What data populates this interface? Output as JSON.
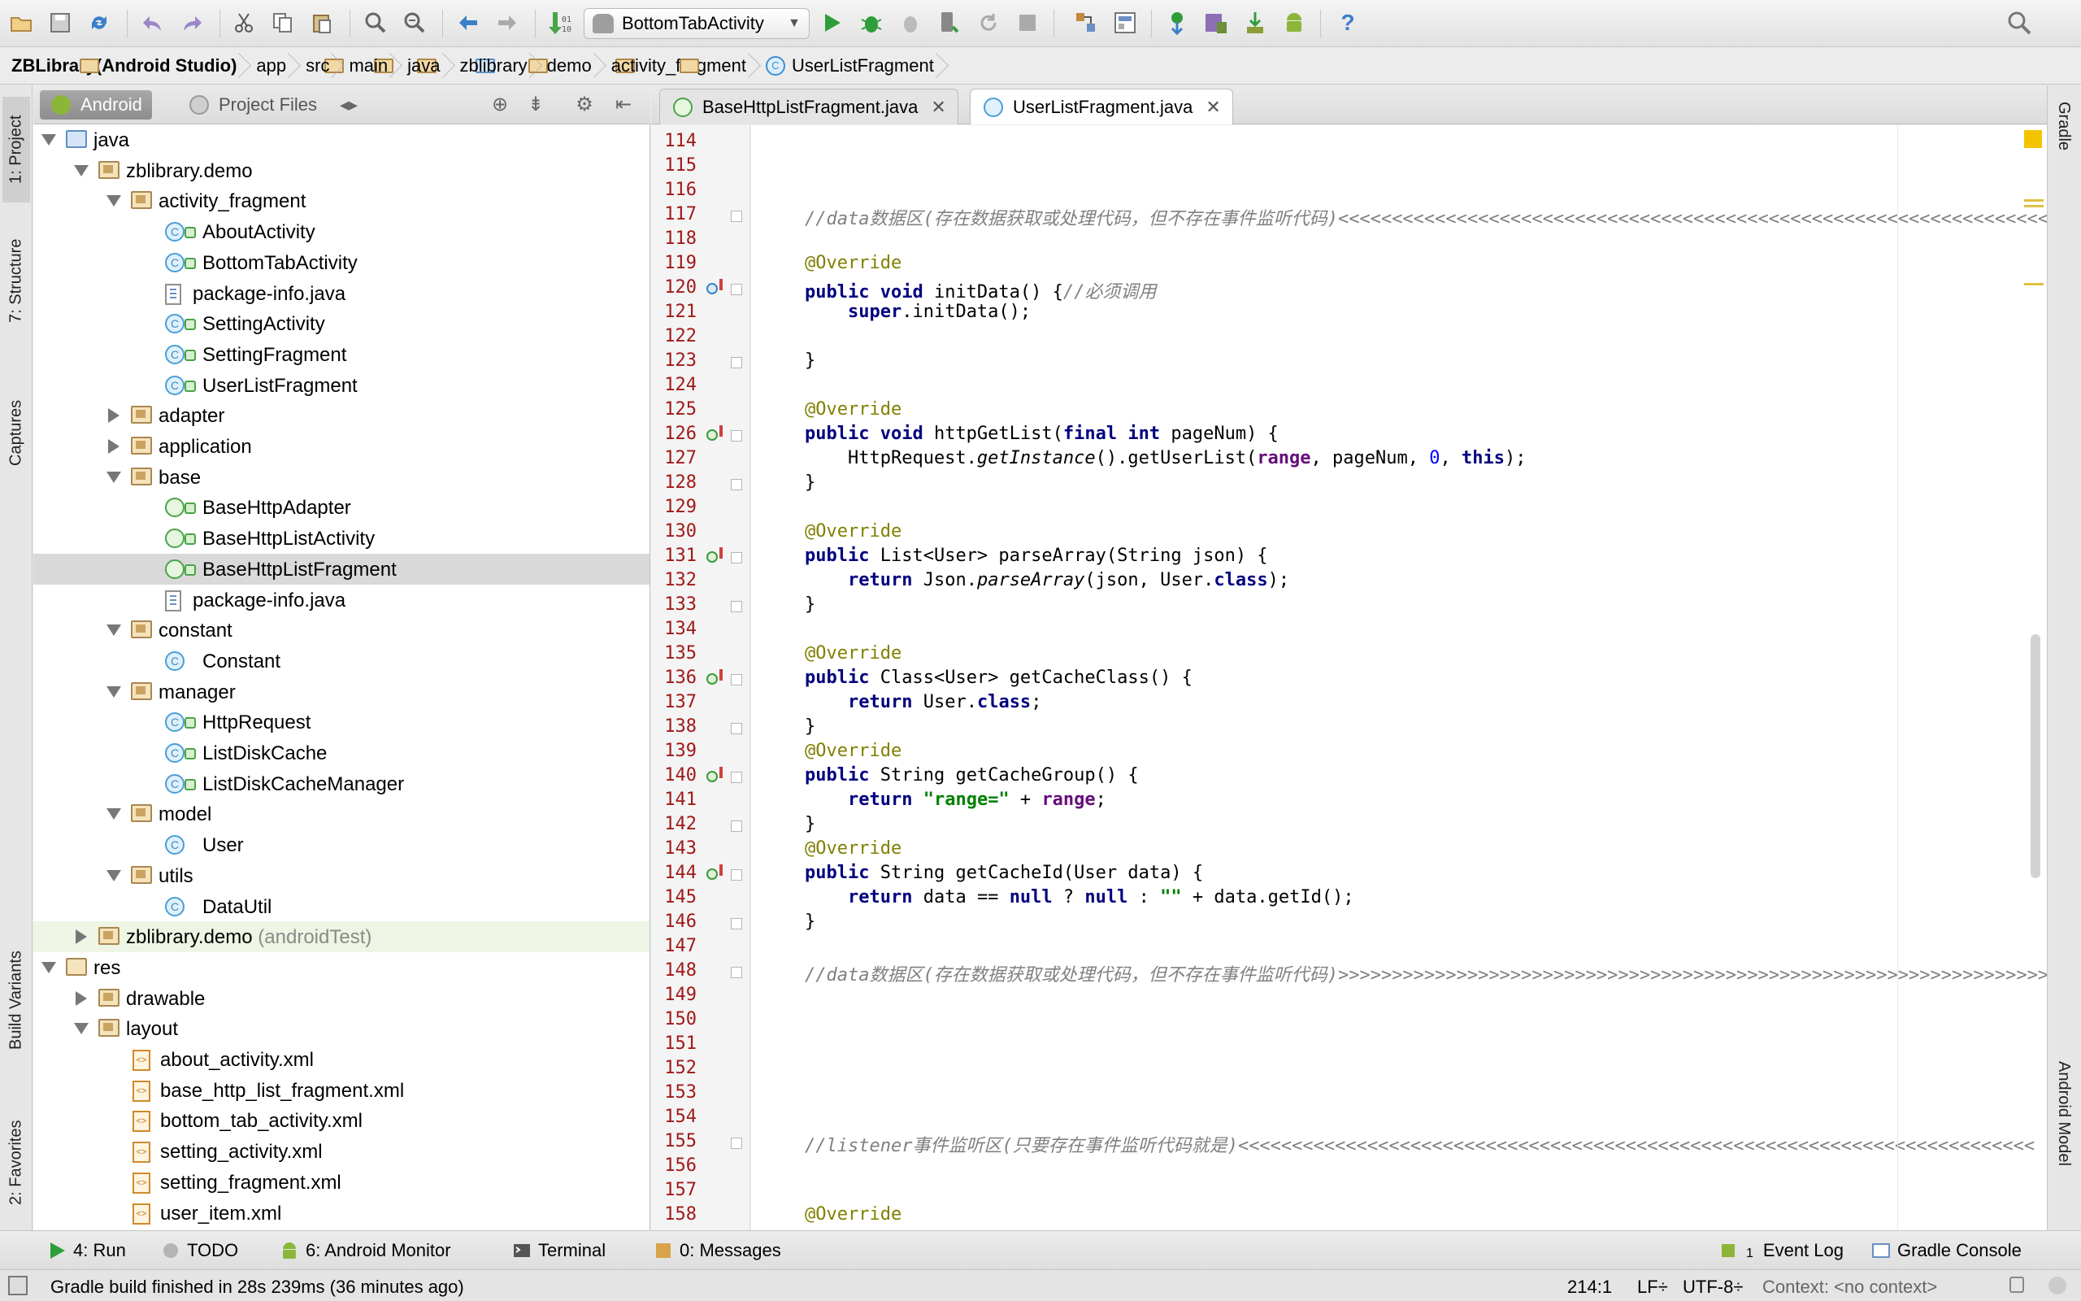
{
  "toolbar": {
    "run_config": "BottomTabActivity"
  },
  "breadcrumb": [
    {
      "label": "ZBLibrary(Android Studio)",
      "type": "project"
    },
    {
      "label": "app",
      "type": "folder"
    },
    {
      "label": "src",
      "type": "folder"
    },
    {
      "label": "main",
      "type": "folder"
    },
    {
      "label": "java",
      "type": "folder"
    },
    {
      "label": "zblibrary",
      "type": "folder"
    },
    {
      "label": "demo",
      "type": "folder"
    },
    {
      "label": "activity_fragment",
      "type": "folder"
    },
    {
      "label": "UserListFragment",
      "type": "class"
    }
  ],
  "left_strip": {
    "project": "1: Project",
    "structure": "7: Structure",
    "captures": "Captures",
    "build_variants": "Build Variants",
    "favorites": "2: Favorites"
  },
  "right_strip": {
    "gradle": "Gradle",
    "android_model": "Android Model"
  },
  "project_panel": {
    "tab_android": "Android",
    "tab_project_files": "Project Files"
  },
  "tree": [
    {
      "label": "java",
      "level": 1,
      "state": "open",
      "icon": "src"
    },
    {
      "label": "zblibrary.demo",
      "level": 2,
      "state": "open",
      "icon": "pkg"
    },
    {
      "label": "activity_fragment",
      "level": 3,
      "state": "open",
      "icon": "pkg"
    },
    {
      "label": "AboutActivity",
      "level": 4,
      "icon": "cls"
    },
    {
      "label": "BottomTabActivity",
      "level": 4,
      "icon": "cls"
    },
    {
      "label": "package-info.java",
      "level": 4,
      "icon": "file"
    },
    {
      "label": "SettingActivity",
      "level": 4,
      "icon": "cls"
    },
    {
      "label": "SettingFragment",
      "level": 4,
      "icon": "cls"
    },
    {
      "label": "UserListFragment",
      "level": 4,
      "icon": "cls"
    },
    {
      "label": "adapter",
      "level": 3,
      "state": "closed",
      "icon": "pkg"
    },
    {
      "label": "application",
      "level": 3,
      "state": "closed",
      "icon": "pkg"
    },
    {
      "label": "base",
      "level": 3,
      "state": "open",
      "icon": "pkg"
    },
    {
      "label": "BaseHttpAdapter",
      "level": 4,
      "icon": "clsg"
    },
    {
      "label": "BaseHttpListActivity",
      "level": 4,
      "icon": "clsg"
    },
    {
      "label": "BaseHttpListFragment",
      "level": 4,
      "icon": "clsg",
      "selected": true
    },
    {
      "label": "package-info.java",
      "level": 4,
      "icon": "file"
    },
    {
      "label": "constant",
      "level": 3,
      "state": "open",
      "icon": "pkg"
    },
    {
      "label": "Constant",
      "level": 4,
      "icon": "cls",
      "nolock": true
    },
    {
      "label": "manager",
      "level": 3,
      "state": "open",
      "icon": "pkg"
    },
    {
      "label": "HttpRequest",
      "level": 4,
      "icon": "cls"
    },
    {
      "label": "ListDiskCache",
      "level": 4,
      "icon": "cls"
    },
    {
      "label": "ListDiskCacheManager",
      "level": 4,
      "icon": "cls"
    },
    {
      "label": "model",
      "level": 3,
      "state": "open",
      "icon": "pkg"
    },
    {
      "label": "User",
      "level": 4,
      "icon": "cls",
      "nolock": true
    },
    {
      "label": "utils",
      "level": 3,
      "state": "open",
      "icon": "pkg"
    },
    {
      "label": "DataUtil",
      "level": 4,
      "icon": "cls",
      "nolock": true
    },
    {
      "label": "zblibrary.demo",
      "suffix": "(androidTest)",
      "level": 2,
      "state": "closed",
      "icon": "pkg",
      "test": true
    },
    {
      "label": "res",
      "level": 1,
      "state": "open",
      "icon": "res"
    },
    {
      "label": "drawable",
      "level": 2,
      "state": "closed",
      "icon": "pkg"
    },
    {
      "label": "layout",
      "level": 2,
      "state": "open",
      "icon": "pkg"
    },
    {
      "label": "about_activity.xml",
      "level": 3,
      "icon": "xml"
    },
    {
      "label": "base_http_list_fragment.xml",
      "level": 3,
      "icon": "xml"
    },
    {
      "label": "bottom_tab_activity.xml",
      "level": 3,
      "icon": "xml"
    },
    {
      "label": "setting_activity.xml",
      "level": 3,
      "icon": "xml"
    },
    {
      "label": "setting_fragment.xml",
      "level": 3,
      "icon": "xml"
    },
    {
      "label": "user_item.xml",
      "level": 3,
      "icon": "xml"
    }
  ],
  "editor_tabs": [
    {
      "label": "BaseHttpListFragment.java",
      "active": false
    },
    {
      "label": "UserListFragment.java",
      "active": true
    }
  ],
  "code_lines": [
    {
      "n": "114",
      "html": ""
    },
    {
      "n": "115",
      "html": ""
    },
    {
      "n": "116",
      "html": ""
    },
    {
      "n": "117",
      "html": "<span class='cm'>//data数据区(存在数据获取或处理代码，但不存在事件监听代码)&lt;&lt;&lt;&lt;&lt;&lt;&lt;&lt;&lt;&lt;&lt;&lt;&lt;&lt;&lt;&lt;&lt;&lt;&lt;&lt;&lt;&lt;&lt;&lt;&lt;&lt;&lt;&lt;&lt;&lt;&lt;&lt;&lt;&lt;&lt;&lt;&lt;&lt;&lt;&lt;&lt;&lt;&lt;&lt;&lt;&lt;&lt;&lt;&lt;&lt;&lt;&lt;&lt;&lt;&lt;&lt;&lt;&lt;&lt;&lt;&lt;&lt;&lt;&lt;&lt;&lt;</span>",
      "fold": true
    },
    {
      "n": "118",
      "html": ""
    },
    {
      "n": "119",
      "html": "<span class='an'>@Override</span>"
    },
    {
      "n": "120",
      "html": "<span class='kw'>public void</span> initData() {<span class='cm'>//必须调用</span>",
      "mark": "o",
      "fold": true
    },
    {
      "n": "121",
      "html": "    <span class='kw'>super</span>.initData();"
    },
    {
      "n": "122",
      "html": ""
    },
    {
      "n": "123",
      "html": "}",
      "fold": true
    },
    {
      "n": "124",
      "html": ""
    },
    {
      "n": "125",
      "html": "<span class='an'>@Override</span>"
    },
    {
      "n": "126",
      "html": "<span class='kw'>public void</span> httpGetList(<span class='kw'>final int</span> pageNum) {",
      "mark": "i",
      "fold": true
    },
    {
      "n": "127",
      "html": "    HttpRequest.<span class='it'>getInstance</span>().getUserList(<span class='fd'>range</span>, pageNum, <span class='nm'>0</span>, <span class='kw'>this</span>);"
    },
    {
      "n": "128",
      "html": "}",
      "fold": true
    },
    {
      "n": "129",
      "html": ""
    },
    {
      "n": "130",
      "html": "<span class='an'>@Override</span>"
    },
    {
      "n": "131",
      "html": "<span class='kw'>public</span> List&lt;User&gt; parseArray(String json) {",
      "mark": "i",
      "fold": true
    },
    {
      "n": "132",
      "html": "    <span class='kw'>return</span> Json.<span class='it'>parseArray</span>(json, User.<span class='kw'>class</span>);"
    },
    {
      "n": "133",
      "html": "}",
      "fold": true
    },
    {
      "n": "134",
      "html": ""
    },
    {
      "n": "135",
      "html": "<span class='an'>@Override</span>"
    },
    {
      "n": "136",
      "html": "<span class='kw'>public</span> Class&lt;User&gt; getCacheClass() {",
      "mark": "i",
      "fold": true
    },
    {
      "n": "137",
      "html": "    <span class='kw'>return</span> User.<span class='kw'>class</span>;"
    },
    {
      "n": "138",
      "html": "}",
      "fold": true
    },
    {
      "n": "139",
      "html": "<span class='an'>@Override</span>"
    },
    {
      "n": "140",
      "html": "<span class='kw'>public</span> String getCacheGroup() {",
      "mark": "i",
      "fold": true
    },
    {
      "n": "141",
      "html": "    <span class='kw'>return</span> <span class='st'>\"range=\"</span> + <span class='fd'>range</span>;"
    },
    {
      "n": "142",
      "html": "}",
      "fold": true
    },
    {
      "n": "143",
      "html": "<span class='an'>@Override</span>"
    },
    {
      "n": "144",
      "html": "<span class='kw'>public</span> String getCacheId(User data) {",
      "mark": "i",
      "fold": true
    },
    {
      "n": "145",
      "html": "    <span class='kw'>return</span> data == <span class='kw'>null</span> ? <span class='kw'>null</span> : <span class='st'>\"\"</span> + data.getId();"
    },
    {
      "n": "146",
      "html": "}",
      "fold": true
    },
    {
      "n": "147",
      "html": ""
    },
    {
      "n": "148",
      "html": "<span class='cm'>//data数据区(存在数据获取或处理代码，但不存在事件监听代码)&gt;&gt;&gt;&gt;&gt;&gt;&gt;&gt;&gt;&gt;&gt;&gt;&gt;&gt;&gt;&gt;&gt;&gt;&gt;&gt;&gt;&gt;&gt;&gt;&gt;&gt;&gt;&gt;&gt;&gt;&gt;&gt;&gt;&gt;&gt;&gt;&gt;&gt;&gt;&gt;&gt;&gt;&gt;&gt;&gt;&gt;&gt;&gt;&gt;&gt;&gt;&gt;&gt;&gt;&gt;&gt;&gt;&gt;&gt;&gt;&gt;&gt;&gt;&gt;&gt;&gt;</span>",
      "fold": true
    },
    {
      "n": "149",
      "html": ""
    },
    {
      "n": "150",
      "html": ""
    },
    {
      "n": "151",
      "html": ""
    },
    {
      "n": "152",
      "html": ""
    },
    {
      "n": "153",
      "html": ""
    },
    {
      "n": "154",
      "html": ""
    },
    {
      "n": "155",
      "html": "<span class='cm'>//listener事件监听区(只要存在事件监听代码就是)&lt;&lt;&lt;&lt;&lt;&lt;&lt;&lt;&lt;&lt;&lt;&lt;&lt;&lt;&lt;&lt;&lt;&lt;&lt;&lt;&lt;&lt;&lt;&lt;&lt;&lt;&lt;&lt;&lt;&lt;&lt;&lt;&lt;&lt;&lt;&lt;&lt;&lt;&lt;&lt;&lt;&lt;&lt;&lt;&lt;&lt;&lt;&lt;&lt;&lt;&lt;&lt;&lt;&lt;&lt;&lt;&lt;&lt;&lt;&lt;&lt;&lt;&lt;&lt;&lt;&lt;&lt;&lt;&lt;&lt;&lt;&lt;&lt;&lt;</span>",
      "fold": true
    },
    {
      "n": "156",
      "html": ""
    },
    {
      "n": "157",
      "html": ""
    },
    {
      "n": "158",
      "html": "<span class='an'>@Override</span>"
    }
  ],
  "bottom_tools": [
    {
      "label": "4: Run",
      "icon": "run-icon"
    },
    {
      "label": "TODO",
      "icon": "todo-icon"
    },
    {
      "label": "6: Android Monitor",
      "icon": "android-icon"
    },
    {
      "label": "Terminal",
      "icon": "terminal-icon"
    },
    {
      "label": "0: Messages",
      "icon": "messages-icon"
    }
  ],
  "bottom_right": {
    "event_log": "Event Log",
    "event_log_count": "1",
    "gradle_console": "Gradle Console"
  },
  "status": {
    "message": "Gradle build finished in 28s 239ms (36 minutes ago)",
    "position": "214:1",
    "line_sep": "LF",
    "encoding": "UTF-8",
    "context": "Context: <no context>"
  }
}
